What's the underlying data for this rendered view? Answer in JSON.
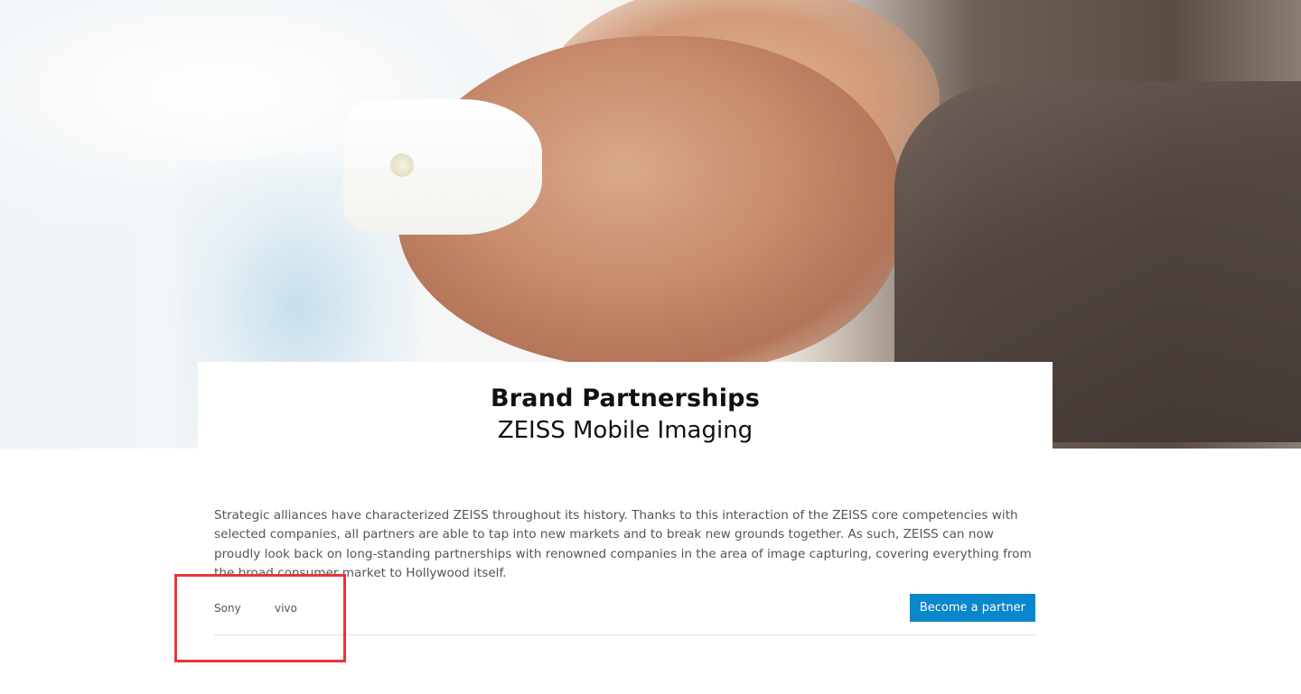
{
  "hero": {
    "image": "handshake-photo"
  },
  "title_card": {
    "title": "Brand Partnerships",
    "subtitle": "ZEISS Mobile Imaging"
  },
  "intro": {
    "text": "Strategic alliances have characterized ZEISS throughout its history. Thanks to this interaction of the ZEISS core competencies with selected companies, all partners are able to tap into new markets and to break new grounds together. As such, ZEISS can now proudly look back on long-standing partnerships with renowned companies in the area of image capturing, covering everything from the broad consumer market to Hollywood itself."
  },
  "tabs": {
    "items": [
      {
        "label": "Sony"
      },
      {
        "label": "vivo"
      }
    ]
  },
  "cta": {
    "label": "Become a partner",
    "color": "#0a86cc"
  },
  "highlight": {
    "color": "#e8353a"
  }
}
